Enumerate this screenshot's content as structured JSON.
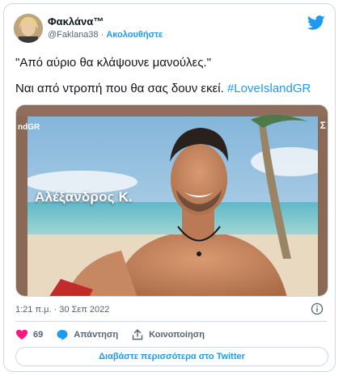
{
  "author": {
    "name": "Φακλάνα™",
    "handle": "@Faklana38",
    "separator": "·",
    "follow_label": "Ακολουθήστε"
  },
  "tweet": {
    "line1": "\"Από αύριο θα κλάψουνε μανούλες.\"",
    "line2_text": "Ναι από ντροπή που θα σας δουν εκεί. ",
    "hashtag": "#LoveIslandGR"
  },
  "media": {
    "caption": "Αλέξανδρος Κ.",
    "corner_left": "ndGR",
    "corner_right": "Σ"
  },
  "meta": {
    "timestamp": "1:21 π.μ. · 30 Σεπ 2022"
  },
  "actions": {
    "likes": "69",
    "reply_label": "Απάντηση",
    "share_label": "Κοινοποίηση"
  },
  "read_more_label": "Διαβάστε περισσότερα στο Twitter",
  "colors": {
    "accent": "#1d9bf0",
    "like": "#f91880",
    "secondary_text": "#536471",
    "border": "#cfd9de"
  }
}
